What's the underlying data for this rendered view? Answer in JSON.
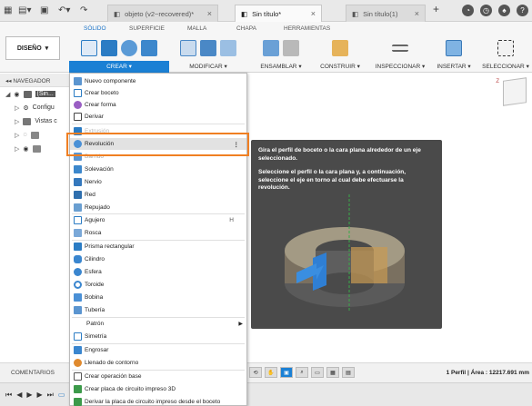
{
  "titlebar": {
    "tabs": [
      {
        "label": "objeto (v2~recovered)*",
        "active": false
      },
      {
        "label": "Sin título*",
        "active": true
      },
      {
        "label": "Sin título(1)",
        "active": false
      }
    ]
  },
  "toolbar": {
    "workspace": "DISEÑO",
    "ribbon_tabs": [
      "SÓLIDO",
      "SUPERFICIE",
      "MALLA",
      "CHAPA",
      "HERRAMIENTAS"
    ],
    "groups": [
      "CREAR",
      "MODIFICAR",
      "ENSAMBLAR",
      "CONSTRUIR",
      "INSPECCIONAR",
      "INSERTAR",
      "SELECCIONAR"
    ]
  },
  "browser": {
    "header": "NAVEGADOR",
    "rows": [
      "(Sin...",
      "Configu",
      "Vistas c",
      "",
      ""
    ]
  },
  "menu": {
    "items": [
      {
        "label": "Nuevo componente",
        "shortcut": ""
      },
      {
        "label": "Crear boceto",
        "shortcut": ""
      },
      {
        "label": "Crear forma",
        "shortcut": ""
      },
      {
        "label": "Derivar",
        "shortcut": ""
      },
      {
        "label": "Extrusión",
        "shortcut": ""
      },
      {
        "label": "Revolución",
        "shortcut": ""
      },
      {
        "label": "Barrido",
        "shortcut": ""
      },
      {
        "label": "Solevación",
        "shortcut": ""
      },
      {
        "label": "Nervio",
        "shortcut": ""
      },
      {
        "label": "Red",
        "shortcut": ""
      },
      {
        "label": "Repujado",
        "shortcut": ""
      },
      {
        "label": "Agujero",
        "shortcut": "H"
      },
      {
        "label": "Rosca",
        "shortcut": ""
      },
      {
        "label": "Prisma rectangular",
        "shortcut": ""
      },
      {
        "label": "Cilindro",
        "shortcut": ""
      },
      {
        "label": "Esfera",
        "shortcut": ""
      },
      {
        "label": "Toroide",
        "shortcut": ""
      },
      {
        "label": "Bobina",
        "shortcut": ""
      },
      {
        "label": "Tubería",
        "shortcut": ""
      },
      {
        "label": "Patrón",
        "shortcut": ""
      },
      {
        "label": "Simetría",
        "shortcut": ""
      },
      {
        "label": "Engrosar",
        "shortcut": ""
      },
      {
        "label": "Llenado de contorno",
        "shortcut": ""
      },
      {
        "label": "Crear operación base",
        "shortcut": ""
      },
      {
        "label": "Crear placa de circuito impreso 3D",
        "shortcut": ""
      },
      {
        "label": "Derivar la placa de circuito impreso desde el boceto",
        "shortcut": ""
      }
    ],
    "highlighted": "Revolución",
    "more_icon": "⋮"
  },
  "tooltip": {
    "text1": "Gira el perfil de boceto o la cara plana alrededor de un eje seleccionado.",
    "text2": "Seleccione el perfil o la cara plana y, a continuación, seleccione el eje en torno al cual debe efectuarse la revolución."
  },
  "statusbar": {
    "comments": "COMENTARIOS",
    "perfil": "1 Perfil | Área : 12217.691 mm"
  },
  "colors": {
    "accent": "#1b80d4",
    "highlight_box": "#f07f22",
    "tooltip_bg": "#4a4a4a"
  }
}
